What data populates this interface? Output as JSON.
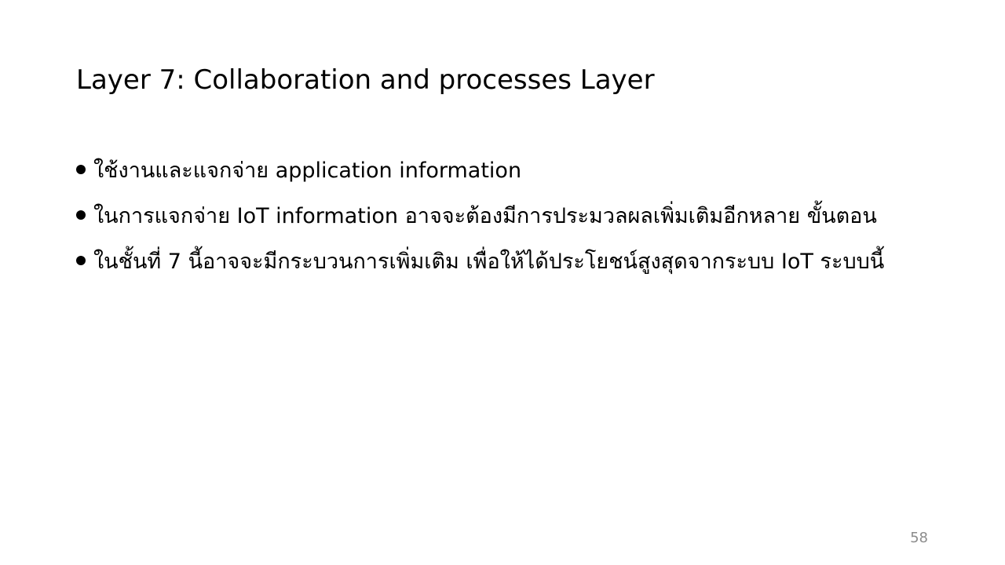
{
  "slide": {
    "title": "Layer 7: Collaboration and processes Layer",
    "bullets": [
      {
        "text": "ใช้งานและแจกจ่าย application information"
      },
      {
        "text": "ในการแจกจ่าย IoT information อาจจะต้องมีการประมวลผลเพิ่มเติมอีกหลาย ขั้นตอน"
      },
      {
        "text": "ในชั้นที่ 7 นี้อาจจะมีกระบวนการเพิ่มเติม เพื่อให้ได้ประโยชน์สูงสุดจากระบบ IoT ระบบนี้"
      }
    ],
    "page_number": "58"
  },
  "colors": {
    "background": "#ffffff",
    "text": "#000000",
    "page_number": "#8c8c8c"
  }
}
